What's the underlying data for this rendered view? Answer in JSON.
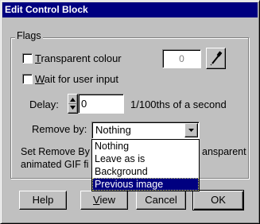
{
  "window": {
    "title": "Edit Control Block"
  },
  "flags": {
    "group_label": "Flags",
    "transparent_colour": {
      "label": "Transparent colour",
      "underline_char": "T",
      "rest": "ransparent colour",
      "checked": false,
      "value": "0"
    },
    "wait_for_input": {
      "label": "Wait for user input",
      "underline_char": "W",
      "rest": "ait for user input",
      "checked": false
    }
  },
  "delay": {
    "label": "Delay:",
    "value": "0",
    "units": "1/100ths of a second"
  },
  "remove_by": {
    "label": "Remove by:",
    "selected": "Nothing",
    "options": [
      "Nothing",
      "Leave as is",
      "Background",
      "Previous image"
    ],
    "highlighted_index": 3
  },
  "info_text": {
    "line1_left": "Set Remove By",
    "line1_right": "ansparent",
    "line2_left": "animated GIF fi"
  },
  "buttons": {
    "help": "Help",
    "view": "View",
    "view_underline": "V",
    "view_rest": "iew",
    "cancel": "Cancel",
    "ok": "OK"
  },
  "icons": {
    "eyedropper": "eyedropper-icon",
    "dropdown": "chevron-down-icon",
    "spin": "spin-arrows-icon"
  }
}
